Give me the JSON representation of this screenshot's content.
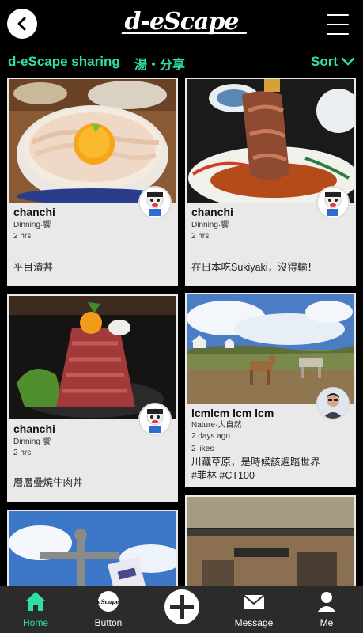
{
  "header": {
    "logo": "d-eScape",
    "back_icon": "chevron-left-icon",
    "menu_icon": "hamburger-menu-icon"
  },
  "subheader": {
    "title": "d-eScape sharing",
    "tag": "湯・分享",
    "sort_label": "Sort"
  },
  "posts": [
    {
      "username": "chanchi",
      "category": "Dinning·饗",
      "time": "2 hrs",
      "likes": "",
      "caption": "平目漬丼",
      "photo": "scallop-rice-bowl"
    },
    {
      "username": "chanchi",
      "category": "Dinning·饗",
      "time": "2 hrs",
      "likes": "",
      "caption": "在日本吃Sukiyaki，沒得輸！",
      "photo": "sukiyaki-beef"
    },
    {
      "username": "chanchi",
      "category": "Dinning·饗",
      "time": "2 hrs",
      "likes": "",
      "caption": "層層疊燒牛肉丼",
      "photo": "roast-beef-bowl"
    },
    {
      "username": "lcmlcm lcm lcm",
      "category": "Nature·大自然",
      "time": "2 days ago",
      "likes": "2 likes",
      "caption_line1": "川藏草原，是時候該遍踏世界",
      "caption_line2": "#菲林 #CT100",
      "photo": "grassland-horses"
    },
    {
      "photo": "christ-statue"
    },
    {
      "photo": "japanese-shop"
    }
  ],
  "bottom_nav": {
    "home": "Home",
    "button": "Button",
    "button_badge": "eScape",
    "message": "Message",
    "me": "Me"
  },
  "colors": {
    "accent": "#2fe0a0",
    "background": "#000000",
    "card": "#e9e9e9",
    "nav": "#2b2b2b"
  }
}
